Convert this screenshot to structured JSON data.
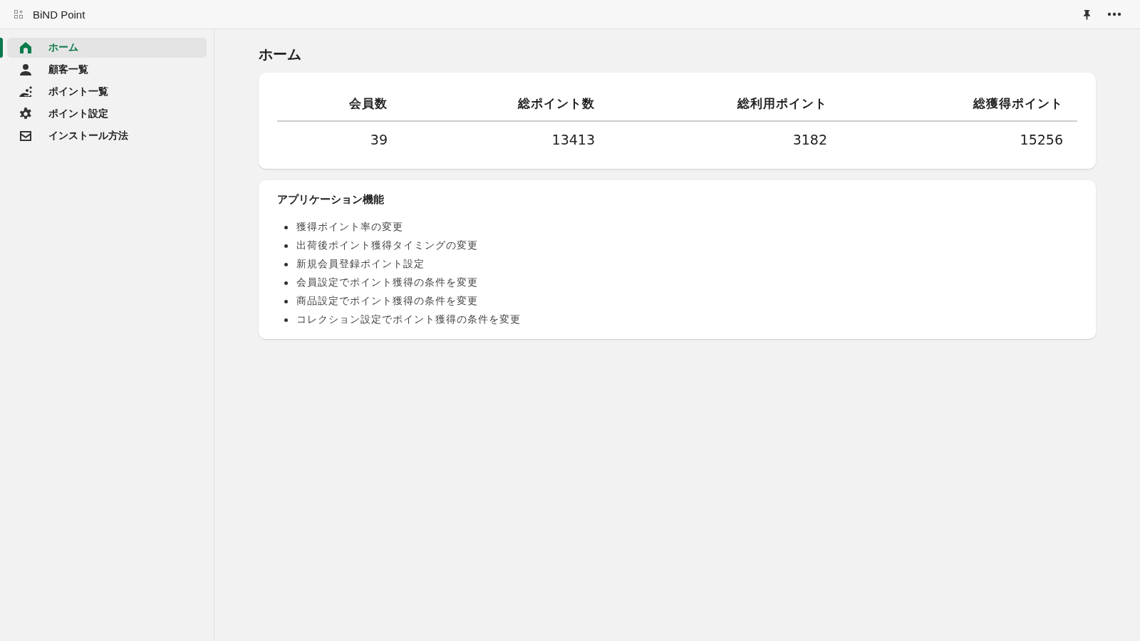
{
  "window": {
    "title": "BiND Point"
  },
  "sidebar": {
    "items": [
      {
        "label": "ホーム",
        "kind": "home",
        "selected": true
      },
      {
        "label": "顧客一覧",
        "kind": "person",
        "selected": false
      },
      {
        "label": "ポイント一覧",
        "kind": "points",
        "selected": false
      },
      {
        "label": "ポイント設定",
        "kind": "gear",
        "selected": false
      },
      {
        "label": "インストール方法",
        "kind": "mail",
        "selected": false
      }
    ]
  },
  "page": {
    "title": "ホーム"
  },
  "stats": {
    "columns": [
      "会員数",
      "総ポイント数",
      "総利用ポイント",
      "総獲得ポイント"
    ],
    "values": [
      "39",
      "13413",
      "3182",
      "15256"
    ]
  },
  "features": {
    "title": "アプリケーション機能",
    "items": [
      "獲得ポイント率の変更",
      "出荷後ポイント獲得タイミングの変更",
      "新規会員登録ポイント設定",
      "会員設定でポイント獲得の条件を変更",
      "商品設定でポイント獲得の条件を変更",
      "コレクション設定でポイント獲得の条件を変更"
    ]
  }
}
